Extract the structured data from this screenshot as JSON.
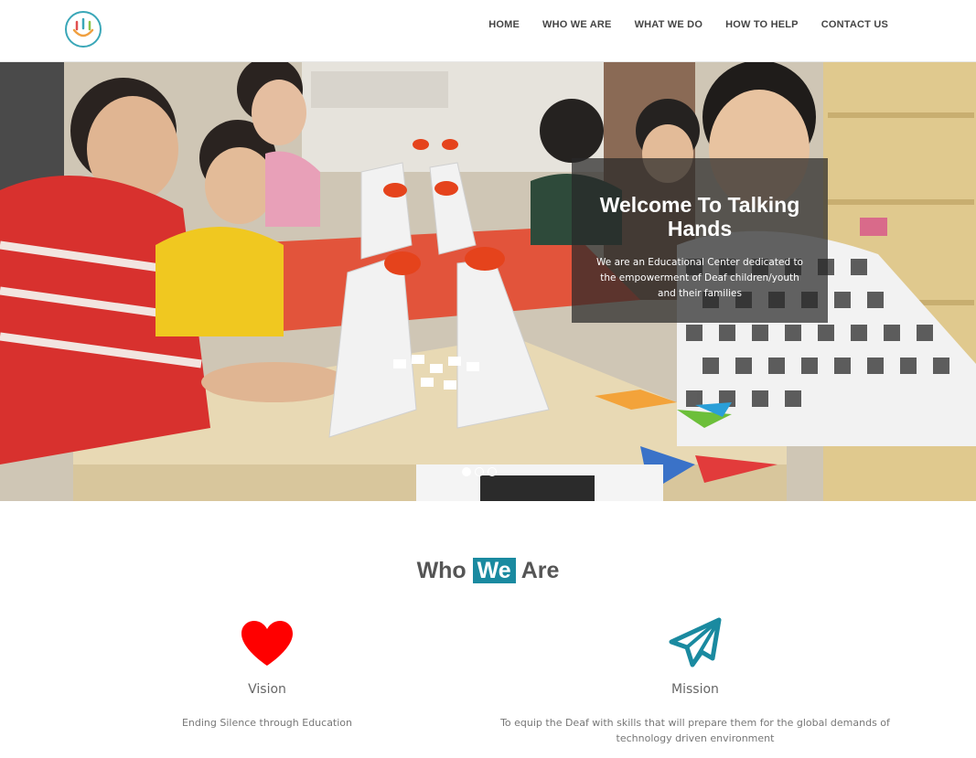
{
  "header": {
    "logo_icon": "talking-hands-logo",
    "nav": {
      "home": "HOME",
      "who_we_are": "WHO WE ARE",
      "what_we_do": "WHAT WE DO",
      "how_to_help": "HOW TO HELP",
      "contact_us": "CONTACT US"
    }
  },
  "hero": {
    "title": "Welcome To Talking Hands",
    "subtitle": "We are an Educational Center dedicated to the empowerment of Deaf children/youth and their families",
    "slides": {
      "active": 1,
      "count": 3
    }
  },
  "who_we_are": {
    "title_part1": "Who",
    "title_highlight": "We",
    "title_part2": "Are",
    "vision": {
      "icon": "heart-icon",
      "heading": "Vision",
      "text": "Ending Silence through Education"
    },
    "mission": {
      "icon": "paper-plane-icon",
      "heading": "Mission",
      "text": "To equip the Deaf with skills that will prepare them for the global demands of technology driven environment"
    }
  },
  "colors": {
    "accent": "#1a8aa0",
    "heart": "#ff0000",
    "nav_text": "#444444",
    "heading_text": "#555555"
  }
}
